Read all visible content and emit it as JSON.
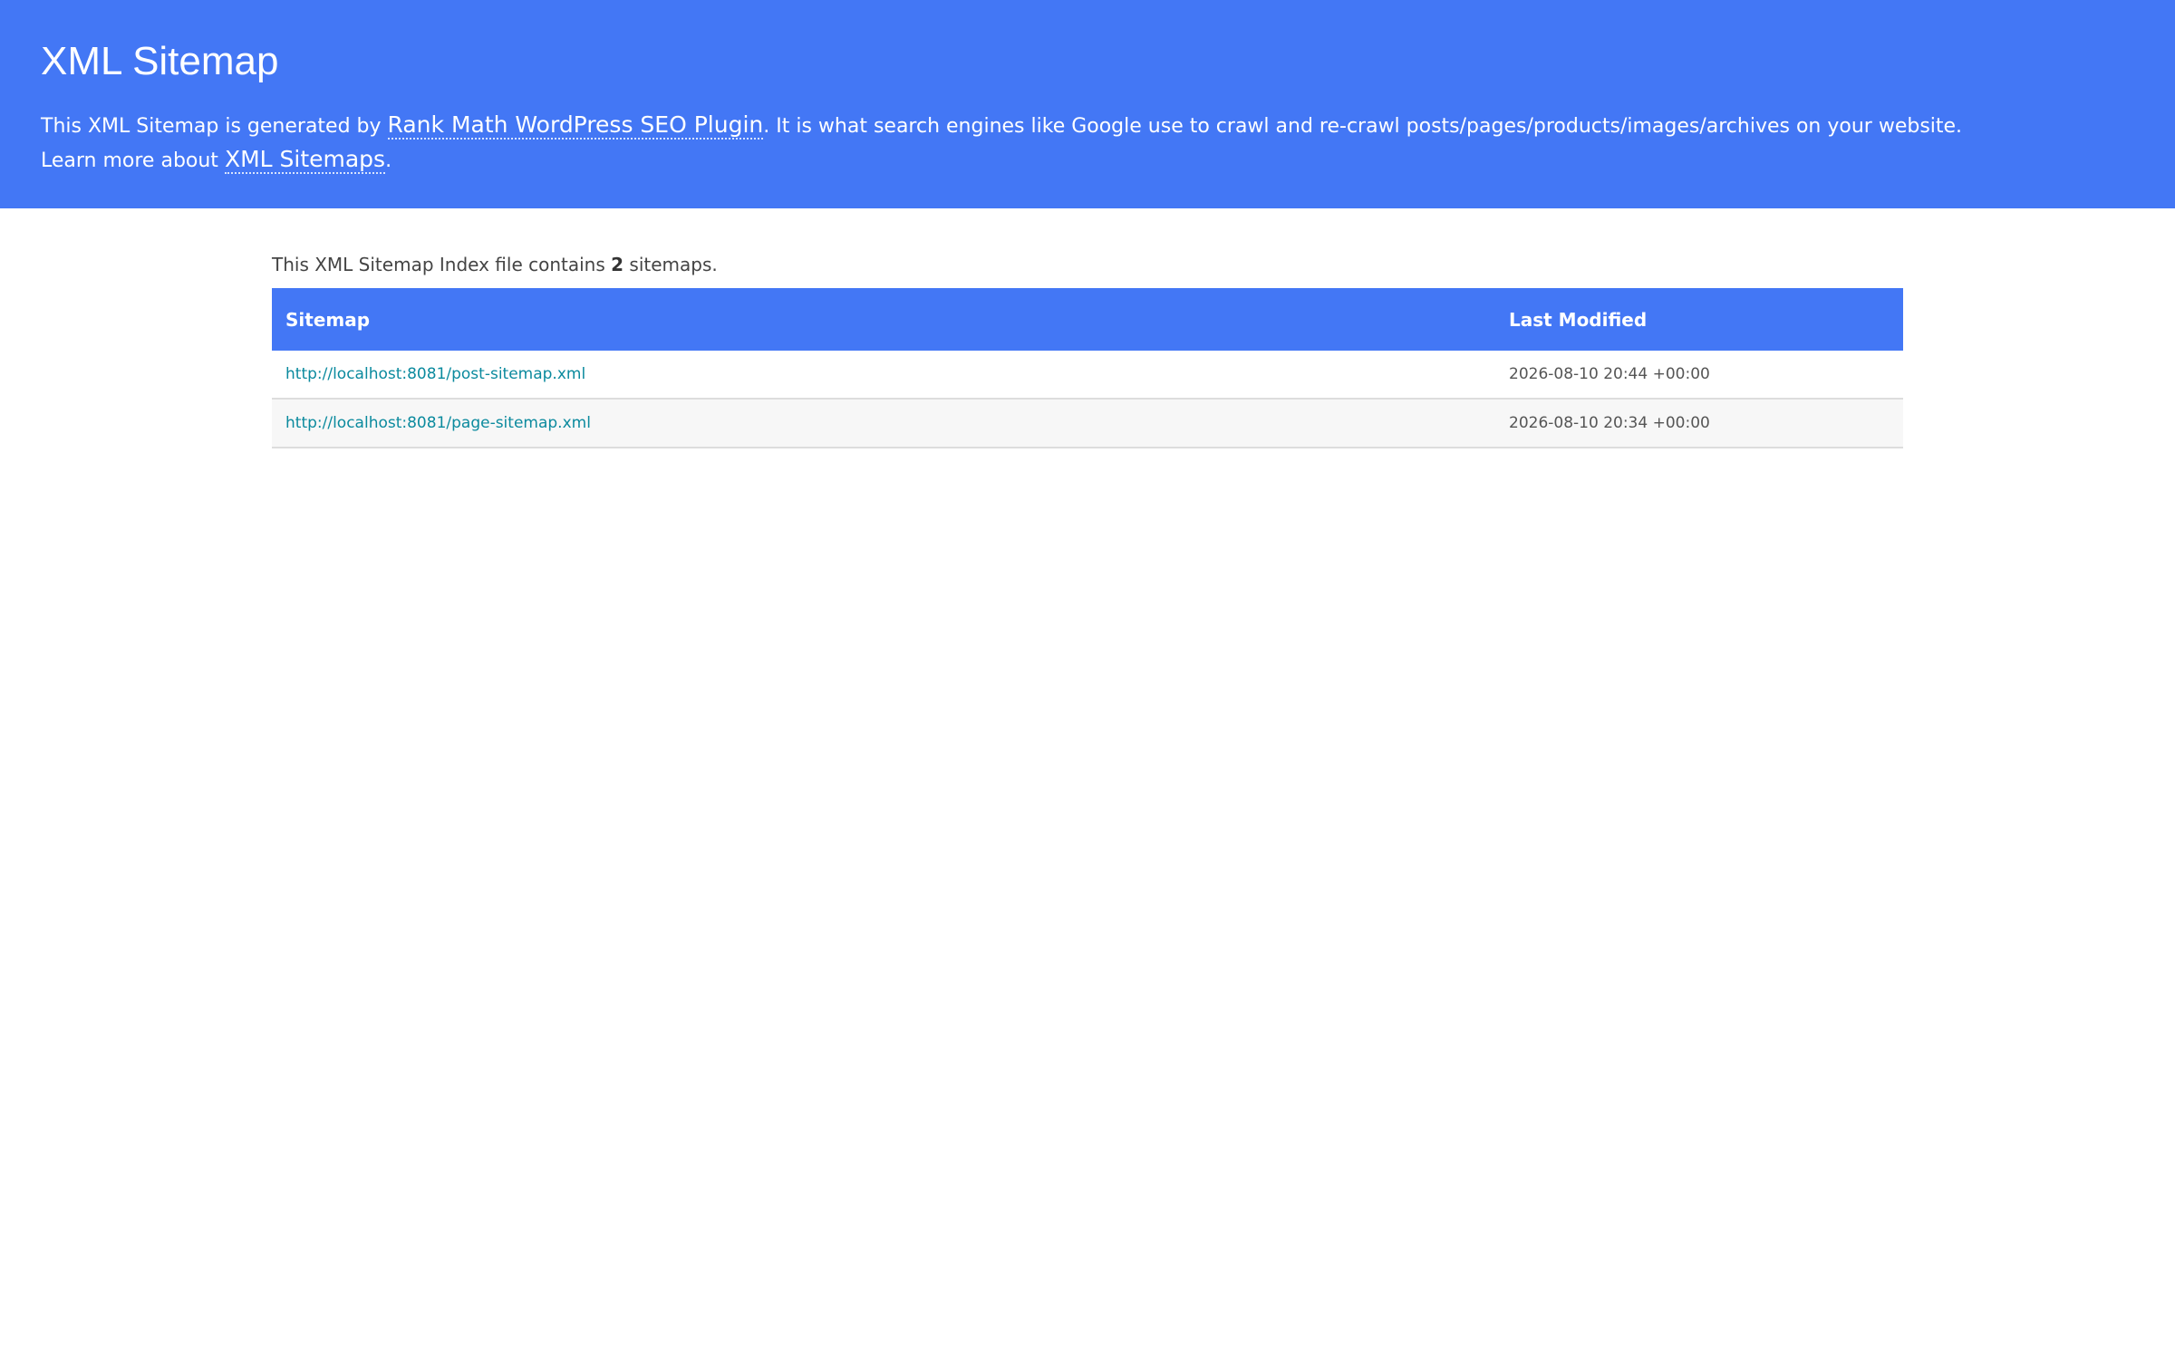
{
  "header": {
    "title": "XML Sitemap",
    "intro_before": "This XML Sitemap is generated by ",
    "plugin_link": "Rank Math WordPress SEO Plugin",
    "intro_after": ". It is what search engines like Google use to crawl and re-crawl posts/pages/products/images/archives on your website.",
    "learn_before": "Learn more about ",
    "learn_link": "XML Sitemaps",
    "learn_after": "."
  },
  "summary": {
    "before": "This XML Sitemap Index file contains ",
    "count": "2",
    "after": " sitemaps."
  },
  "table": {
    "columns": [
      "Sitemap",
      "Last Modified"
    ],
    "rows": [
      {
        "url": "http://localhost:8081/post-sitemap.xml",
        "modified": "2026-08-10 20:44 +00:00"
      },
      {
        "url": "http://localhost:8081/page-sitemap.xml",
        "modified": "2026-08-10 20:34 +00:00"
      }
    ]
  },
  "colors": {
    "header_bg": "#4377f5",
    "link": "#0b8a9e"
  }
}
